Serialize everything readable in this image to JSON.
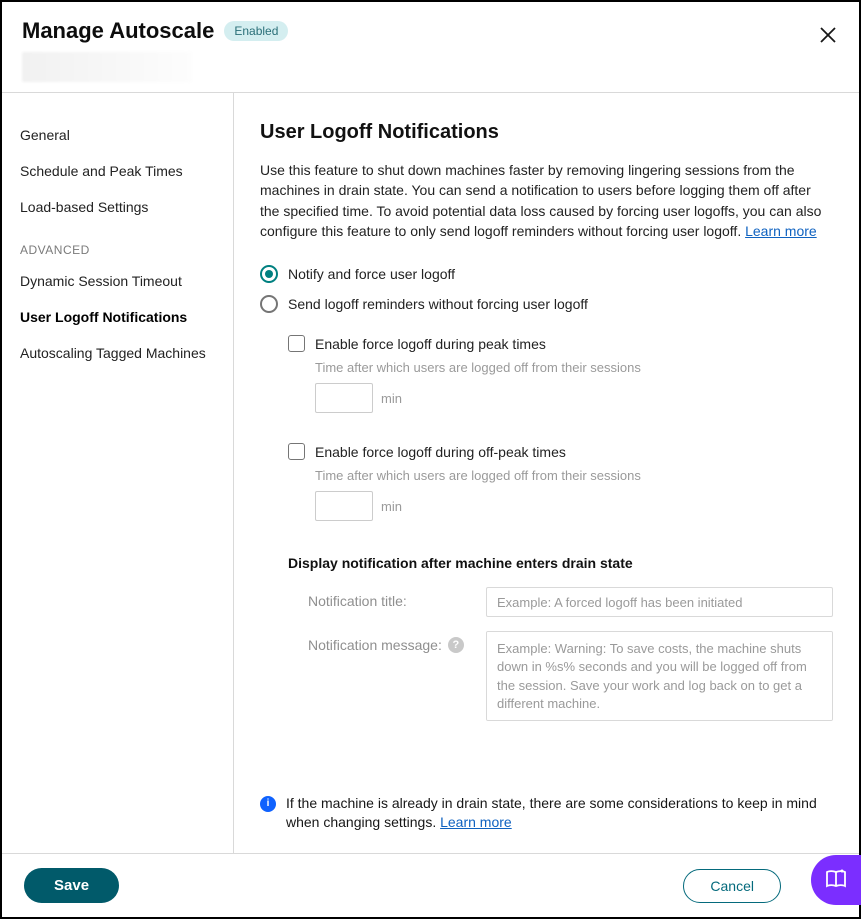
{
  "header": {
    "title": "Manage Autoscale",
    "status_badge": "Enabled"
  },
  "sidebar": {
    "items": [
      {
        "label": "General",
        "active": false
      },
      {
        "label": "Schedule and Peak Times",
        "active": false
      },
      {
        "label": "Load-based Settings",
        "active": false
      }
    ],
    "section_label": "ADVANCED",
    "advanced_items": [
      {
        "label": "Dynamic Session Timeout",
        "active": false
      },
      {
        "label": "User Logoff Notifications",
        "active": true
      },
      {
        "label": "Autoscaling Tagged Machines",
        "active": false
      }
    ]
  },
  "main": {
    "title": "User Logoff Notifications",
    "description": "Use this feature to shut down machines faster by removing lingering sessions from the machines in drain state. You can send a notification to users before logging them off after the specified time. To avoid potential data loss caused by forcing user logoffs, you can also configure this feature to only send logoff reminders without forcing user logoff. ",
    "learn_more_label": "Learn more",
    "radio_notify_force": "Notify and force user logoff",
    "radio_reminders_only": "Send logoff reminders without forcing user logoff",
    "peak": {
      "check_label": "Enable force logoff during peak times",
      "hint": "Time after which users are logged off from their sessions",
      "value": "",
      "unit": "min"
    },
    "offpeak": {
      "check_label": "Enable force logoff during off-peak times",
      "hint": "Time after which users are logged off from their sessions",
      "value": "",
      "unit": "min"
    },
    "drain_heading": "Display notification after machine enters drain state",
    "notif_title_label": "Notification title:",
    "notif_title_placeholder": "Example: A forced logoff has been initiated",
    "notif_msg_label": "Notification message:",
    "notif_msg_placeholder": "Example: Warning: To save costs, the machine shuts down in %s% seconds and you will be logged off from the session. Save your work and log back on to get a different machine.",
    "info_text": "If the machine is already in drain state, there are some considerations to keep in mind when changing settings. ",
    "info_learn_more": "Learn more"
  },
  "footer": {
    "save_label": "Save",
    "cancel_label": "Cancel"
  }
}
